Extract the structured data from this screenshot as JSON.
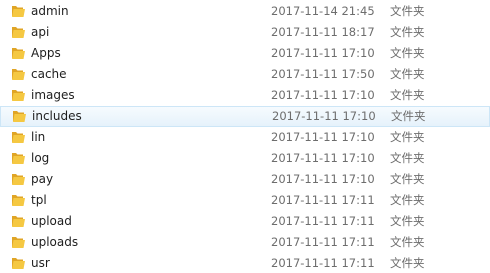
{
  "file_list": {
    "items": [
      {
        "name": "admin",
        "date": "2017-11-14 21:45",
        "type": "文件夹",
        "icon": "folder-icon",
        "selected": false
      },
      {
        "name": "api",
        "date": "2017-11-11 18:17",
        "type": "文件夹",
        "icon": "folder-icon",
        "selected": false
      },
      {
        "name": "Apps",
        "date": "2017-11-11 17:10",
        "type": "文件夹",
        "icon": "folder-icon",
        "selected": false
      },
      {
        "name": "cache",
        "date": "2017-11-11 17:50",
        "type": "文件夹",
        "icon": "folder-icon",
        "selected": false
      },
      {
        "name": "images",
        "date": "2017-11-11 17:10",
        "type": "文件夹",
        "icon": "folder-icon",
        "selected": false
      },
      {
        "name": "includes",
        "date": "2017-11-11 17:10",
        "type": "文件夹",
        "icon": "folder-icon",
        "selected": true
      },
      {
        "name": "lin",
        "date": "2017-11-11 17:10",
        "type": "文件夹",
        "icon": "folder-icon",
        "selected": false
      },
      {
        "name": "log",
        "date": "2017-11-11 17:10",
        "type": "文件夹",
        "icon": "folder-icon",
        "selected": false
      },
      {
        "name": "pay",
        "date": "2017-11-11 17:10",
        "type": "文件夹",
        "icon": "folder-icon",
        "selected": false
      },
      {
        "name": "tpl",
        "date": "2017-11-11 17:11",
        "type": "文件夹",
        "icon": "folder-icon",
        "selected": false
      },
      {
        "name": "upload",
        "date": "2017-11-11 17:11",
        "type": "文件夹",
        "icon": "folder-icon",
        "selected": false
      },
      {
        "name": "uploads",
        "date": "2017-11-11 17:11",
        "type": "文件夹",
        "icon": "folder-icon",
        "selected": false
      },
      {
        "name": "usr",
        "date": "2017-11-11 17:11",
        "type": "文件夹",
        "icon": "folder-icon",
        "selected": false
      }
    ]
  },
  "colors": {
    "folder_front": "#f5c842",
    "folder_back": "#e0a526",
    "selection_bg": "#e6f2fb",
    "selection_border": "#cde6f7"
  }
}
